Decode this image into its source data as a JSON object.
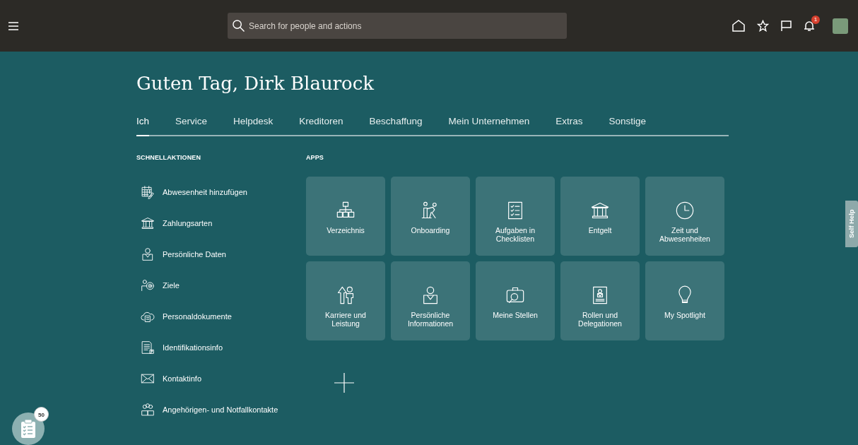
{
  "topbar": {
    "search": {
      "placeholder": "Search for people and actions"
    },
    "notification_count": "1"
  },
  "greeting": "Guten Tag, Dirk Blaurock",
  "tabs": [
    {
      "label": "Ich",
      "selected": true
    },
    {
      "label": "Service",
      "selected": false
    },
    {
      "label": "Helpdesk",
      "selected": false
    },
    {
      "label": "Kreditoren",
      "selected": false
    },
    {
      "label": "Beschaffung",
      "selected": false
    },
    {
      "label": "Mein Unternehmen",
      "selected": false
    },
    {
      "label": "Extras",
      "selected": false
    },
    {
      "label": "Sonstige",
      "selected": false
    }
  ],
  "quick_actions": {
    "heading": "SCHNELLAKTIONEN",
    "items": [
      {
        "label": "Abwesenheit hinzufügen",
        "kind": "calendar"
      },
      {
        "label": "Zahlungsarten",
        "kind": "bank"
      },
      {
        "label": "Persönliche Daten",
        "kind": "person"
      },
      {
        "label": "Ziele",
        "kind": "target"
      },
      {
        "label": "Personaldokumente",
        "kind": "cloud"
      },
      {
        "label": "Identifikationsinfo",
        "kind": "document"
      },
      {
        "label": "Kontaktinfo",
        "kind": "envelope"
      },
      {
        "label": "Angehörigen- und Notfallkontakte",
        "kind": "group"
      }
    ]
  },
  "apps": {
    "heading": "APPS",
    "items": [
      {
        "label": "Verzeichnis",
        "kind": "hierarchy"
      },
      {
        "label": "Onboarding",
        "kind": "people"
      },
      {
        "label": "Aufgaben in Checklisten",
        "kind": "checklist"
      },
      {
        "label": "Entgelt",
        "kind": "bank"
      },
      {
        "label": "Zeit und Abwesenheiten",
        "kind": "clock"
      },
      {
        "label": "Karriere und Leistung",
        "kind": "career"
      },
      {
        "label": "Persönliche Informationen",
        "kind": "person"
      },
      {
        "label": "Meine Stellen",
        "kind": "briefcase"
      },
      {
        "label": "Rollen und Delegationen",
        "kind": "badge"
      },
      {
        "label": "My Spotlight",
        "kind": "bulb"
      }
    ]
  },
  "tasks_count": "50",
  "self_help": "Self Help"
}
